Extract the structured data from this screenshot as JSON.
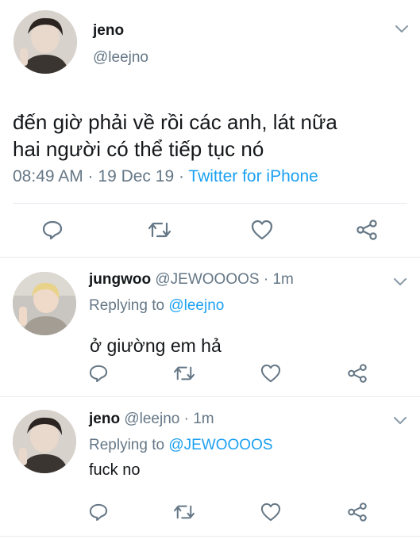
{
  "main_tweet": {
    "display_name": "jeno",
    "handle": "@leejno",
    "text_line1": "đến giờ phải về rồi các anh, lát nữa",
    "text_line2": "hai người có thể tiếp tục nó",
    "timestamp": "08:49 AM · 19 Dec 19 · ",
    "source": "Twitter for iPhone"
  },
  "replies": [
    {
      "display_name": "jungwoo",
      "handle": "@JEWOOOOS",
      "time": " · 1m",
      "replying_prefix": "Replying to ",
      "replying_to": "@leejno",
      "text": "ở giường em hả"
    },
    {
      "display_name": "jeno",
      "handle": "@leejno",
      "time": " · 1m",
      "replying_prefix": "Replying to ",
      "replying_to": "@JEWOOOOS",
      "text": "fuck no"
    }
  ],
  "icons": [
    "reply-icon",
    "retweet-icon",
    "like-icon",
    "share-icon",
    "chevron-down-icon"
  ],
  "colors": {
    "accent": "#1da1f2",
    "muted": "#657786",
    "text": "#14171a",
    "divider": "#e6ecf0"
  }
}
